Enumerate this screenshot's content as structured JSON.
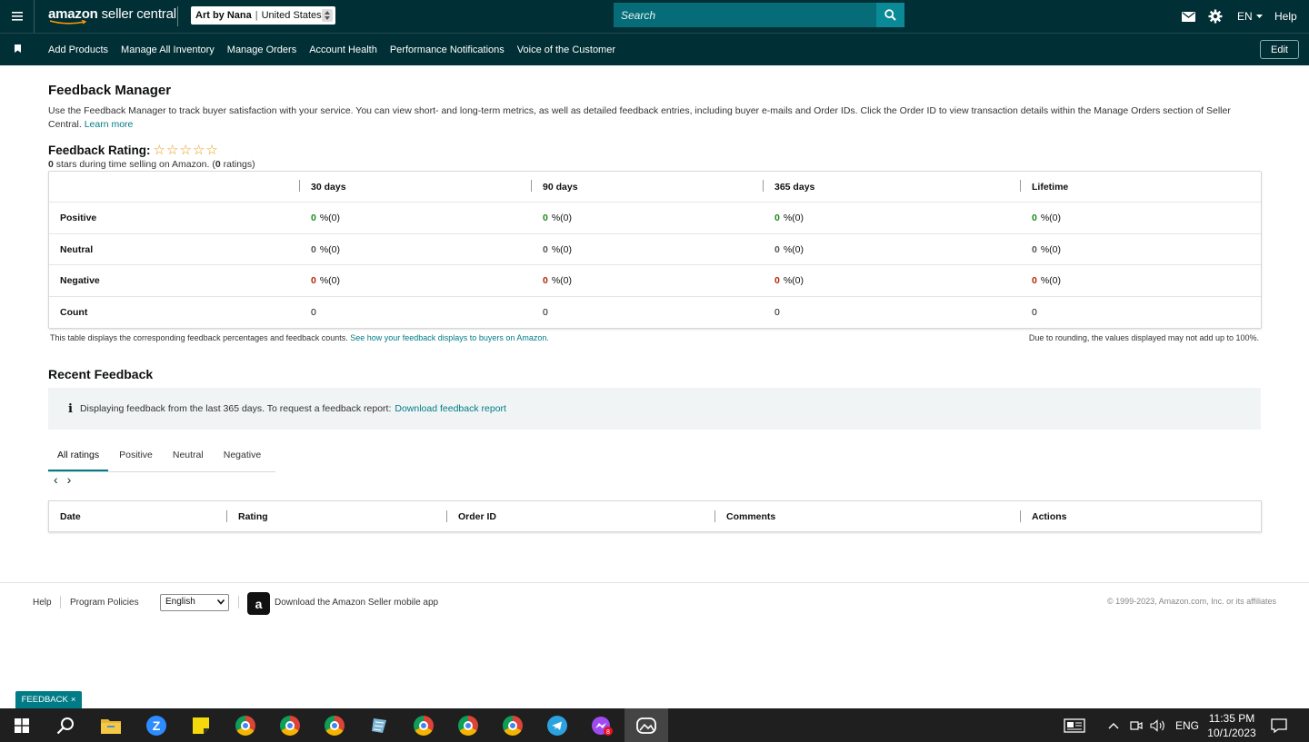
{
  "header": {
    "logo_text_bold": "amazon",
    "logo_text": " seller central",
    "store_name": "Art by Nana",
    "store_region": "United States",
    "search_placeholder": "Search",
    "lang": "EN",
    "help": "Help"
  },
  "nav": {
    "items": [
      "Add Products",
      "Manage All Inventory",
      "Manage Orders",
      "Account Health",
      "Performance Notifications",
      "Voice of the Customer"
    ],
    "edit": "Edit"
  },
  "page": {
    "title": "Feedback Manager",
    "intro": "Use the Feedback Manager to track buyer satisfaction with your service. You can view short- and long-term metrics, as well as detailed feedback entries, including buyer e-mails and Order IDs. Click the Order ID to view transaction details within the Manage Orders section of Seller Central.",
    "learn_more": "Learn more",
    "rating_label": "Feedback Rating:",
    "rating_stars": 0,
    "rating_sub_stars": "0",
    "rating_sub_mid": " stars during time selling on Amazon. (",
    "rating_sub_count": "0",
    "rating_sub_end": " ratings)"
  },
  "feedback_table": {
    "columns": [
      "30 days",
      "90 days",
      "365 days",
      "Lifetime"
    ],
    "rows": [
      {
        "label": "Positive",
        "values": [
          "0",
          "0",
          "0",
          "0"
        ],
        "suffix": "%(0)"
      },
      {
        "label": "Neutral",
        "values": [
          "0",
          "0",
          "0",
          "0"
        ],
        "suffix": "%(0)"
      },
      {
        "label": "Negative",
        "values": [
          "0",
          "0",
          "0",
          "0"
        ],
        "suffix": "%(0)"
      },
      {
        "label": "Count",
        "values": [
          "0",
          "0",
          "0",
          "0"
        ]
      }
    ],
    "note_left": "This table displays the corresponding feedback percentages and feedback counts.",
    "note_left_link": "See how your feedback displays to buyers on Amazon.",
    "note_right": "Due to rounding, the values displayed may not add up to 100%."
  },
  "recent": {
    "title": "Recent Feedback",
    "info_text": "Displaying feedback from the last 365 days. To request a feedback report:",
    "info_link": "Download feedback report",
    "tabs": [
      "All ratings",
      "Positive",
      "Neutral",
      "Negative"
    ],
    "columns": [
      "Date",
      "Rating",
      "Order ID",
      "Comments",
      "Actions"
    ]
  },
  "footer": {
    "help": "Help",
    "policies": "Program Policies",
    "language": "English",
    "app_text": "Download the Amazon Seller mobile app",
    "copyright": "© 1999-2023, Amazon.com, Inc. or its affiliates"
  },
  "feedback_tab": "FEEDBACK",
  "taskbar": {
    "lang": "ENG",
    "time": "11:35 PM",
    "date": "10/1/2023"
  },
  "colors": {
    "header_bg": "#002f36",
    "accent": "#017c86",
    "positive": "#1a8a1a",
    "negative": "#b12704",
    "star": "#e79a15"
  }
}
